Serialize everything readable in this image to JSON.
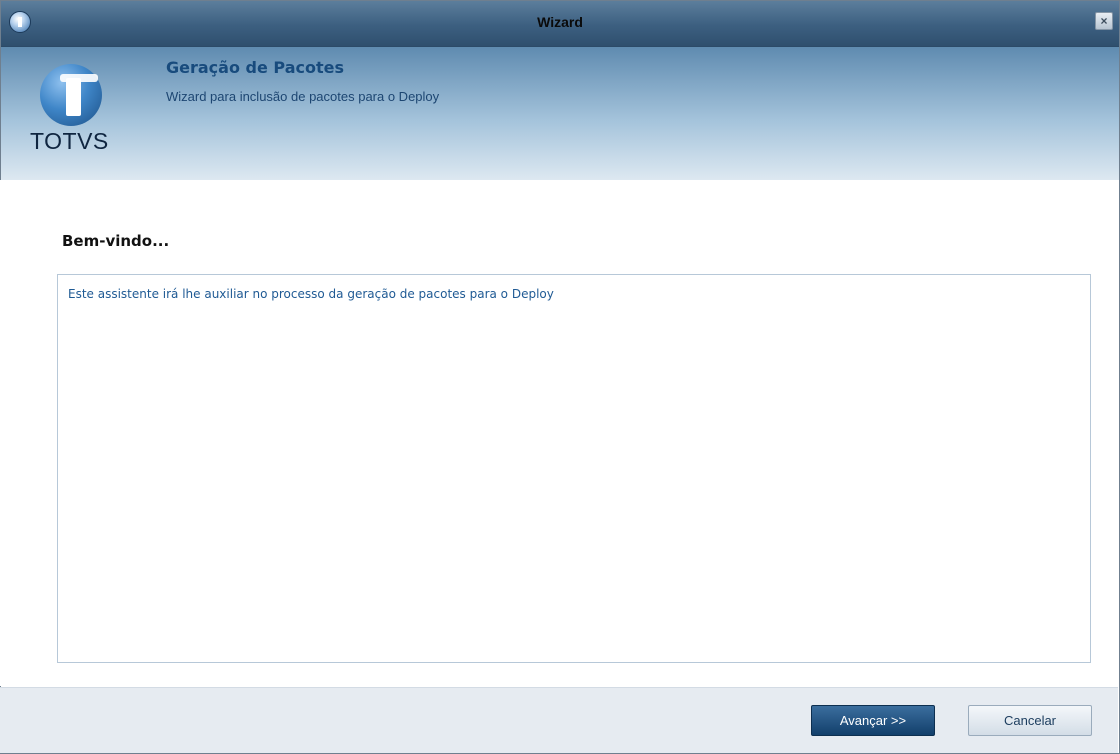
{
  "window": {
    "title": "Wizard",
    "close_glyph": "×"
  },
  "header": {
    "logo_text": "TOTVS",
    "title": "Geração de Pacotes",
    "subtitle": "Wizard para inclusão de pacotes para o Deploy"
  },
  "main": {
    "heading": "Bem-vindo...",
    "description": "Este assistente irá lhe auxiliar no processo da geração de pacotes para o Deploy"
  },
  "footer": {
    "next_label": "Avançar >>",
    "cancel_label": "Cancelar"
  },
  "icons": {
    "app": "app-icon",
    "close": "close-icon",
    "logo": "totvs-logo"
  },
  "colors": {
    "accent": "#184b7d",
    "primary_button": "#123f6b",
    "header_gradient_top": "#5f8bb0",
    "footer_bg": "#e6ebf1"
  }
}
